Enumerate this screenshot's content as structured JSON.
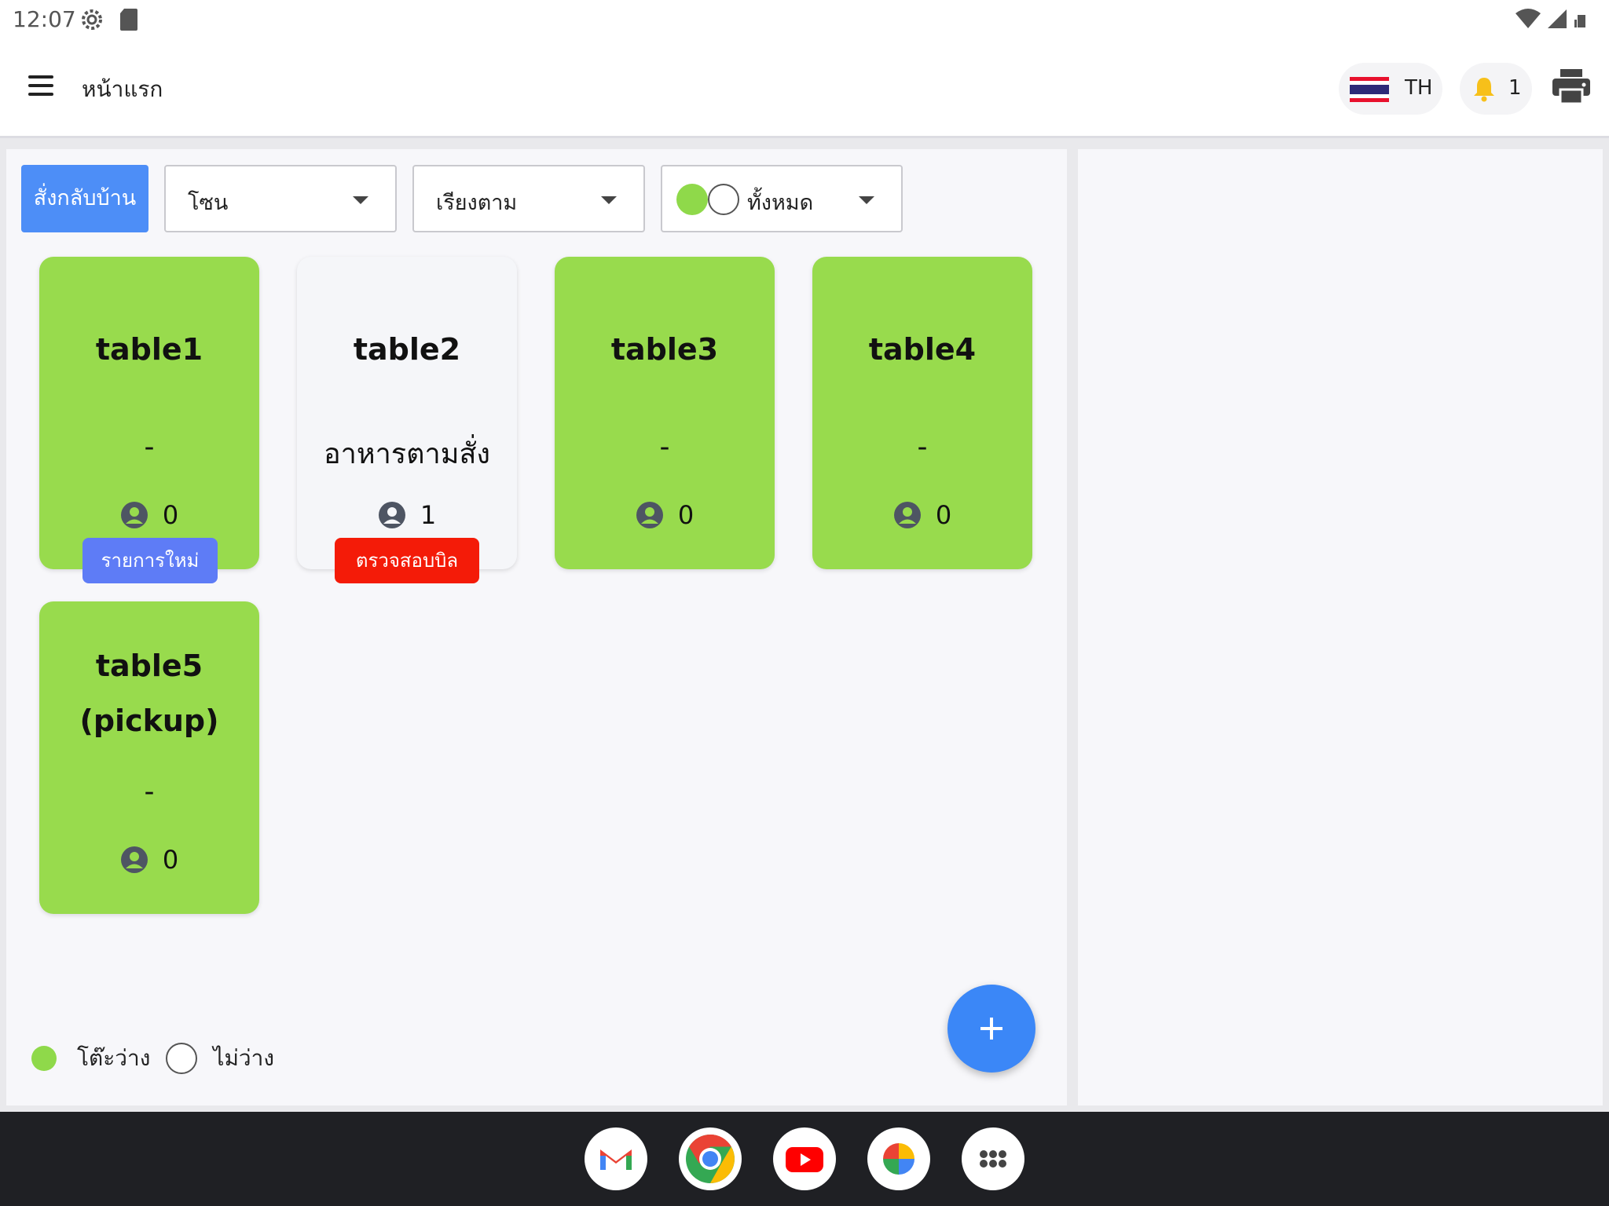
{
  "status_bar": {
    "time": "12:07"
  },
  "app_bar": {
    "title": "หน้าแรก",
    "language": "TH",
    "notification_count": "1"
  },
  "filters": {
    "takehome_label": "สั่งกลับบ้าน",
    "zone_label": "โซน",
    "sort_label": "เรียงตาม",
    "status_label": "ทั้งหมด"
  },
  "tables": [
    {
      "name": "table1",
      "subtitle": "-",
      "guests": "0",
      "badge": "รายการใหม่",
      "status": "free"
    },
    {
      "name": "table2",
      "subtitle": "อาหารตามสั่ง",
      "guests": "1",
      "badge": "ตรวจสอบบิล",
      "status": "busy"
    },
    {
      "name": "table3",
      "subtitle": "-",
      "guests": "0",
      "status": "free"
    },
    {
      "name": "table4",
      "subtitle": "-",
      "guests": "0",
      "status": "free"
    },
    {
      "name_line1": "table5",
      "name_line2": "(pickup)",
      "subtitle": "-",
      "guests": "0",
      "status": "free"
    }
  ],
  "legend": {
    "free_label": "โต๊ะว่าง",
    "busy_label": "ไม่ว่าง"
  },
  "colors": {
    "free": "#98db4d",
    "busy": "#f5f6f9",
    "accent": "#4d8ef7",
    "badge_new": "#5e7cf6",
    "badge_bill": "#f41b08"
  },
  "dock": [
    "gmail-icon",
    "chrome-icon",
    "youtube-icon",
    "photos-icon",
    "app-launcher-icon"
  ]
}
